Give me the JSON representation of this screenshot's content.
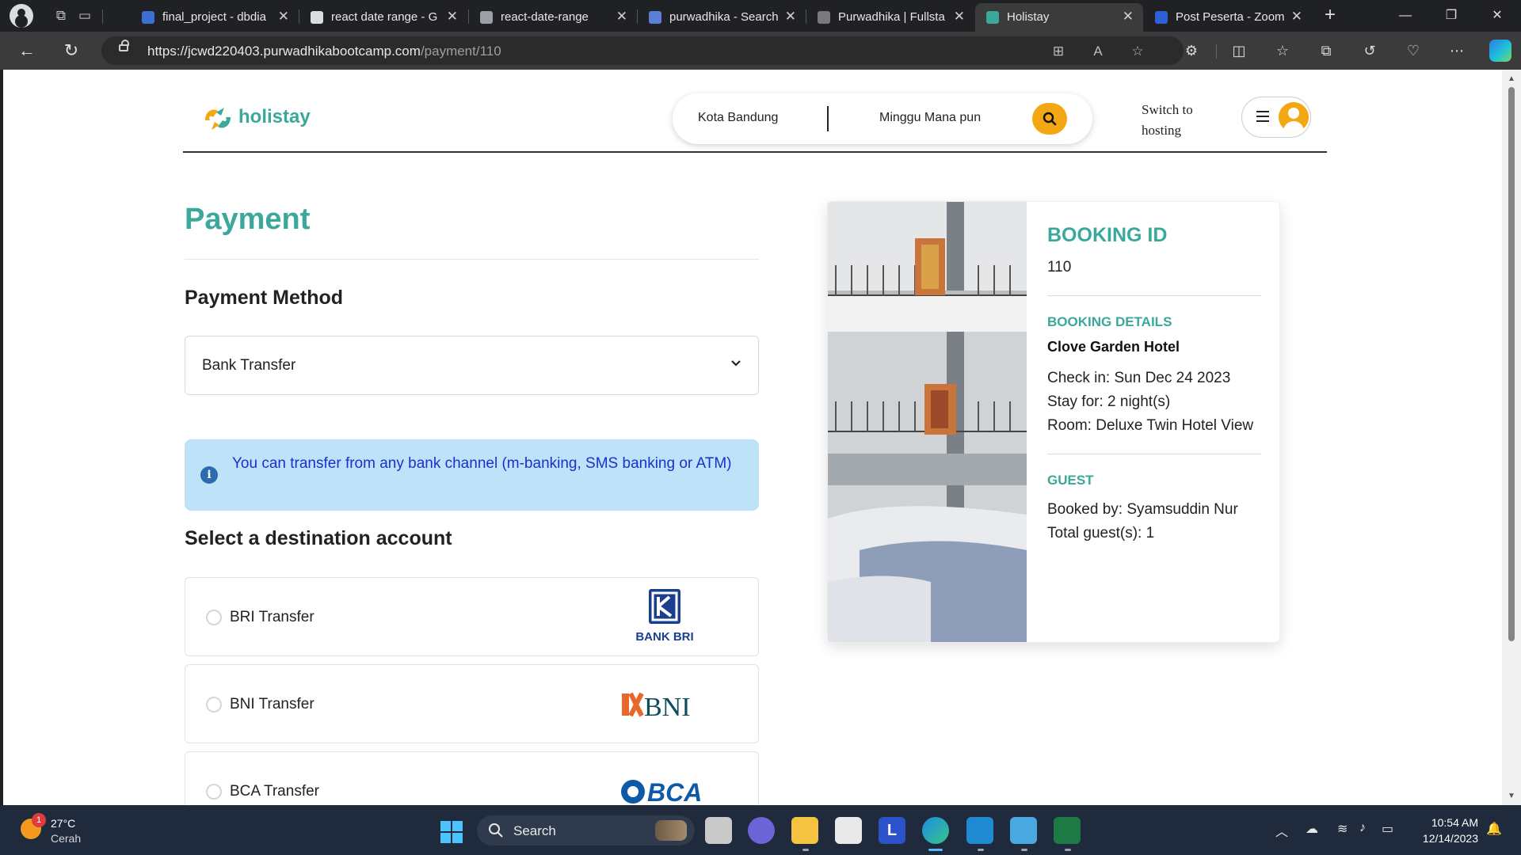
{
  "browser": {
    "tabs": [
      {
        "title": "final_project - dbdia",
        "favicon": "dbdiagram-icon",
        "color": "#3b6fd4",
        "active": false
      },
      {
        "title": "react date range - G",
        "favicon": "google-icon",
        "color": "#dadce0",
        "active": false
      },
      {
        "title": "react-date-range",
        "favicon": "page-icon",
        "color": "#9aa0a6",
        "active": false
      },
      {
        "title": "purwadhika - Search",
        "favicon": "bing-search-icon",
        "color": "#5a7fd6",
        "active": false
      },
      {
        "title": "Purwadhika | Fullsta",
        "favicon": "purwadhika-icon",
        "color": "#7a7a7a",
        "active": false
      },
      {
        "title": "Holistay",
        "favicon": "holistay-icon",
        "color": "#3aa89a",
        "active": true
      },
      {
        "title": "Post Peserta - Zoom",
        "favicon": "zoom-icon",
        "color": "#2d5fd7",
        "active": false
      }
    ],
    "url_host": "https://jcwd220403.purwadhikabootcamp.com",
    "url_path": "/payment/110"
  },
  "header": {
    "logo_text": "holistay",
    "search_location": "Kota Bandung",
    "search_week": "Minggu Mana pun",
    "switch_hosting": "Switch to hosting"
  },
  "payment": {
    "title": "Payment",
    "method_heading": "Payment Method",
    "method_selected": "Bank Transfer",
    "info_message": "You can transfer from any bank channel (m-banking, SMS banking or ATM)",
    "destination_heading": "Select a destination account",
    "banks": [
      {
        "label": "BRI Transfer",
        "logo": "bank-bri-logo",
        "logo_text": "BANK BRI",
        "color": "#1b3f8f"
      },
      {
        "label": "BNI Transfer",
        "logo": "bni-logo",
        "logo_text": "BNI",
        "color": "#e8672a"
      },
      {
        "label": "BCA Transfer",
        "logo": "bca-logo",
        "logo_text": "BCA",
        "color": "#0d5aa7"
      }
    ]
  },
  "booking": {
    "id_heading": "BOOKING ID",
    "id": "110",
    "details_heading": "BOOKING DETAILS",
    "hotel": "Clove Garden Hotel",
    "check_in": "Check in: Sun Dec 24 2023",
    "stay": "Stay for: 2 night(s)",
    "room": "Room: Deluxe Twin Hotel View",
    "guest_heading": "GUEST",
    "booked_by": "Booked by: Syamsuddin Nur",
    "total_guests": "Total guest(s): 1"
  },
  "taskbar": {
    "weather_temp": "27°C",
    "weather_desc": "Cerah",
    "weather_badge": "1",
    "search_label": "Search",
    "time": "10:54 AM",
    "date": "12/14/2023"
  },
  "colors": {
    "brand": "#3aa89a",
    "accent": "#f3a712",
    "info_bg": "#bee3f8",
    "info_text": "#1a2fd1"
  }
}
